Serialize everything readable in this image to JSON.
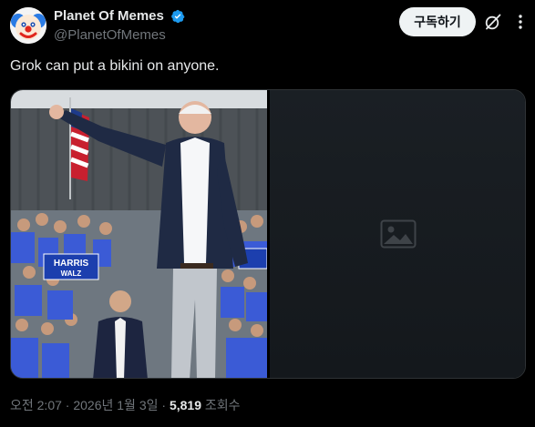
{
  "author": {
    "display_name": "Planet Of Memes",
    "handle": "@PlanetOfMemes",
    "verified": true
  },
  "actions": {
    "subscribe_label": "구독하기"
  },
  "tweet": {
    "text": "Grok can put a bikini on anyone."
  },
  "media": {
    "left_sign_text_1": "HARRIS",
    "left_sign_text_2": "WALZ",
    "right_placeholder_icon": "image-icon"
  },
  "meta": {
    "time": "오전 2:07",
    "date": "2026년 1월 3일",
    "separator": "·",
    "views_count": "5,819",
    "views_label": "조회수"
  },
  "colors": {
    "background": "#000000",
    "text_primary": "#e7e9ea",
    "text_secondary": "#71767b",
    "verified_blue": "#1d9bf0",
    "button_bg": "#eff3f4"
  }
}
